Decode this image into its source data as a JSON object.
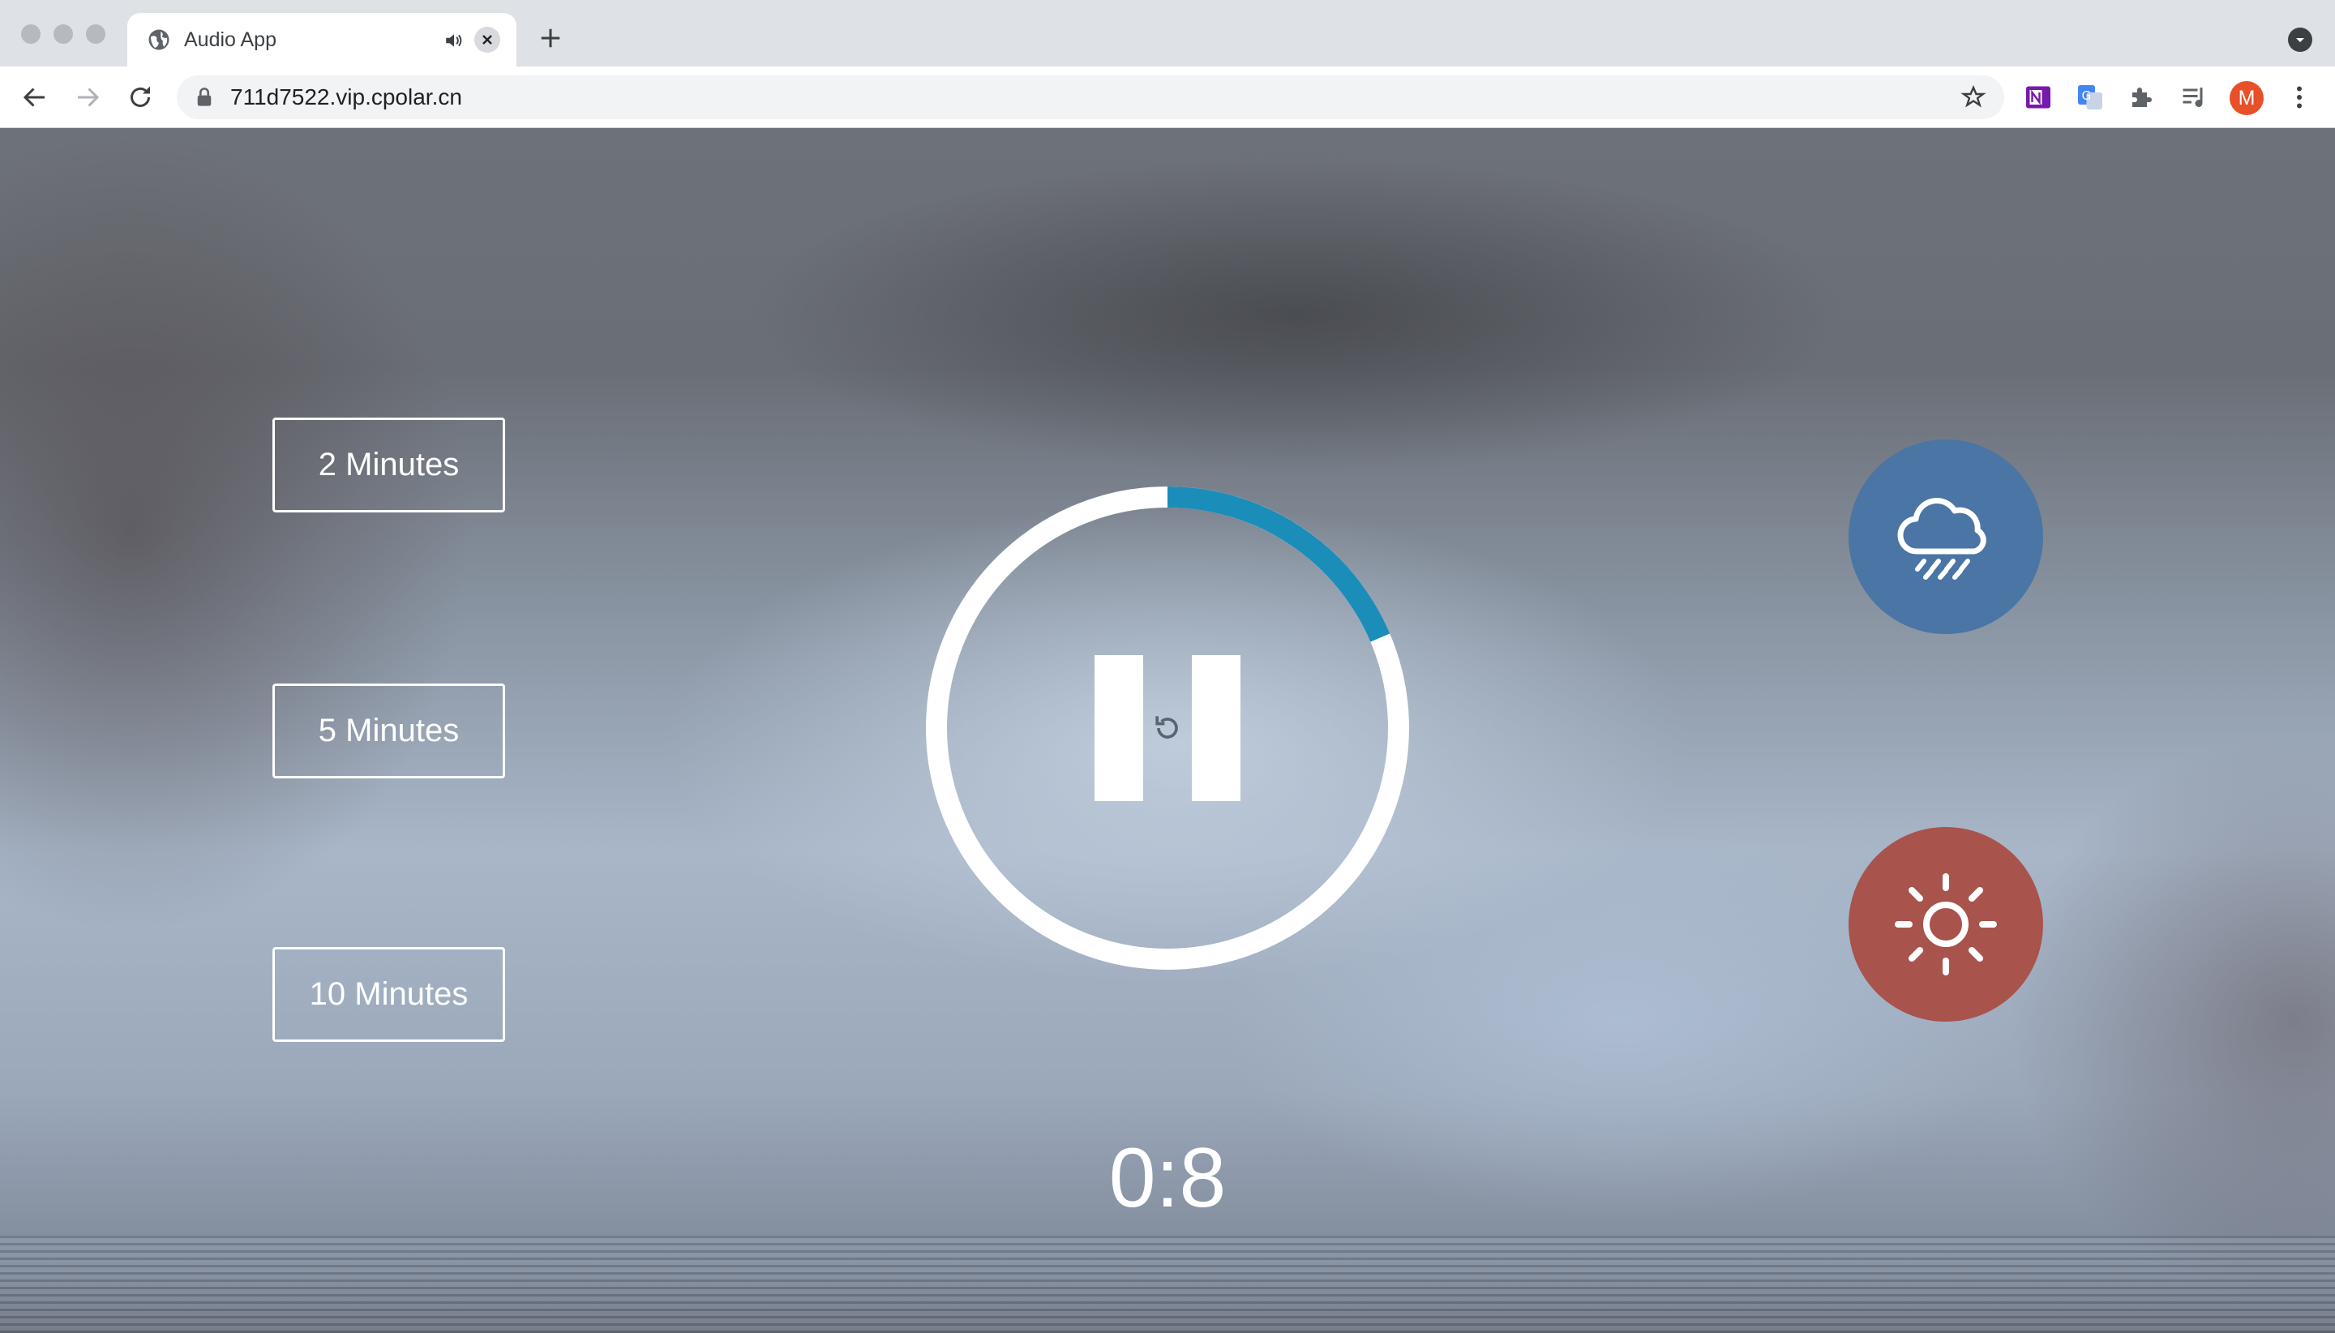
{
  "browser": {
    "tab_title": "Audio App",
    "url": "711d7522.vip.cpolar.cn",
    "avatar_initial": "M",
    "icons": {
      "tab": "globe-icon",
      "audio": "speaker-icon",
      "close": "close-icon",
      "new_tab": "plus-icon",
      "back": "back-arrow-icon",
      "forward": "forward-arrow-icon",
      "reload": "reload-icon",
      "lock": "lock-icon",
      "bookmark": "star-icon",
      "extensions": [
        "onenote-icon",
        "translate-icon",
        "puzzle-icon",
        "media-control-icon"
      ],
      "menu": "kebab-menu-icon"
    }
  },
  "durations": [
    {
      "label": "2 Minutes"
    },
    {
      "label": "5 Minutes"
    },
    {
      "label": "10 Minutes"
    }
  ],
  "player": {
    "state": "playing",
    "progress_fraction": 0.186,
    "time_display": "0:8",
    "colors": {
      "ring": "#ffffff",
      "progress": "#1b8db9"
    }
  },
  "sounds": [
    {
      "name": "rain",
      "icon": "cloud-rain-icon",
      "color": "#4a75a5"
    },
    {
      "name": "summer",
      "icon": "sun-icon",
      "color": "#a8534c"
    }
  ]
}
